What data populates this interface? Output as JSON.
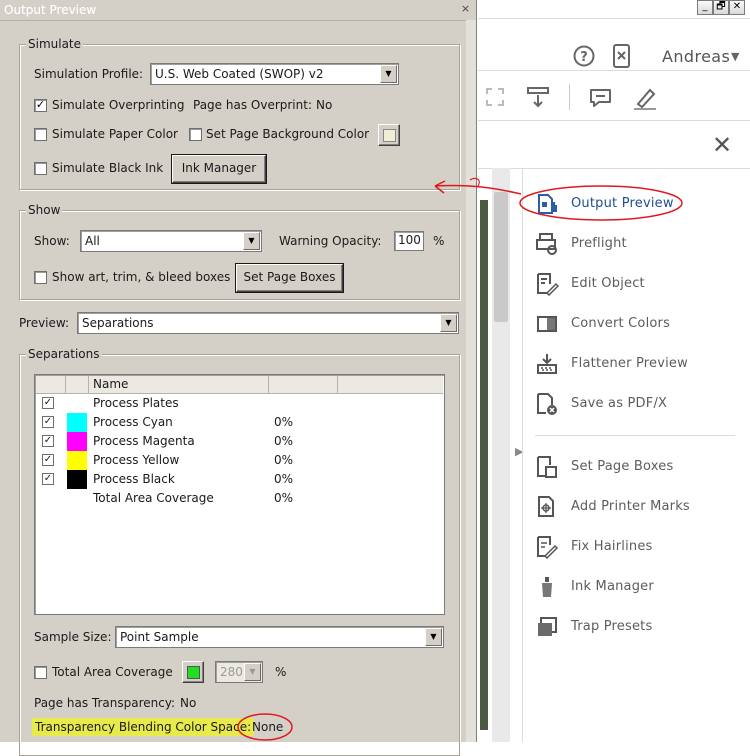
{
  "dialog": {
    "title": "Output Preview",
    "close_glyph": "×",
    "simulate": {
      "group_label": "Simulate",
      "profile_label": "Simulation Profile:",
      "profile_value": "U.S. Web Coated (SWOP) v2",
      "overprint_label": "Simulate Overprinting",
      "overprint_checked": true,
      "has_overprint_label": "Page has Overprint:",
      "has_overprint_value": "No",
      "paper_color_label": "Simulate Paper Color",
      "bg_color_label": "Set Page Background Color",
      "black_ink_label": "Simulate Black Ink",
      "ink_manager_button": "Ink Manager"
    },
    "show": {
      "group_label": "Show",
      "show_label": "Show:",
      "show_value": "All",
      "warning_label": "Warning Opacity:",
      "warning_value": "100",
      "warning_unit": "%",
      "boxes_label": "Show art, trim, & bleed boxes",
      "set_boxes_button": "Set Page Boxes"
    },
    "preview_label": "Preview:",
    "preview_value": "Separations",
    "separations": {
      "group_label": "Separations",
      "column_name": "Name",
      "rows": [
        {
          "name": "Process Plates",
          "percent": "",
          "checked": true,
          "color": ""
        },
        {
          "name": "Process Cyan",
          "percent": "0%",
          "checked": true,
          "color": "#00ffff"
        },
        {
          "name": "Process Magenta",
          "percent": "0%",
          "checked": true,
          "color": "#ff00ff"
        },
        {
          "name": "Process Yellow",
          "percent": "0%",
          "checked": true,
          "color": "#ffff00"
        },
        {
          "name": "Process Black",
          "percent": "0%",
          "checked": true,
          "color": "#000000"
        },
        {
          "name": "Total Area Coverage",
          "percent": "0%",
          "checked": false,
          "color": ""
        }
      ],
      "sample_size_label": "Sample Size:",
      "sample_size_value": "Point Sample",
      "tac_label": "Total Area Coverage",
      "tac_value": "280",
      "tac_unit": "%",
      "tac_swatch_color": "#22dd22",
      "transparency_label": "Page has Transparency:",
      "transparency_value": "No",
      "blend_label": "Transparency Blending Color Space:",
      "blend_value": "None"
    }
  },
  "app": {
    "user_name": "Andreas",
    "window_buttons": [
      "_",
      "🗗",
      "✕"
    ],
    "tools": [
      {
        "label": "Output Preview",
        "icon": "output-preview-icon",
        "active": true
      },
      {
        "label": "Preflight",
        "icon": "preflight-icon"
      },
      {
        "label": "Edit Object",
        "icon": "edit-object-icon"
      },
      {
        "label": "Convert Colors",
        "icon": "convert-colors-icon"
      },
      {
        "label": "Flattener Preview",
        "icon": "flattener-preview-icon"
      },
      {
        "label": "Save as PDF/X",
        "icon": "save-pdfx-icon"
      },
      {
        "label": "Set Page Boxes",
        "icon": "set-page-boxes-icon"
      },
      {
        "label": "Add Printer Marks",
        "icon": "printer-marks-icon"
      },
      {
        "label": "Fix Hairlines",
        "icon": "fix-hairlines-icon"
      },
      {
        "label": "Ink Manager",
        "icon": "ink-manager-icon"
      },
      {
        "label": "Trap Presets",
        "icon": "trap-presets-icon"
      }
    ]
  },
  "colors": {
    "dialog_bg": "#d4d0c8",
    "highlight": "#e8e94a",
    "annotation_red": "#e0191e",
    "active_tool": "#1f4f8f"
  }
}
